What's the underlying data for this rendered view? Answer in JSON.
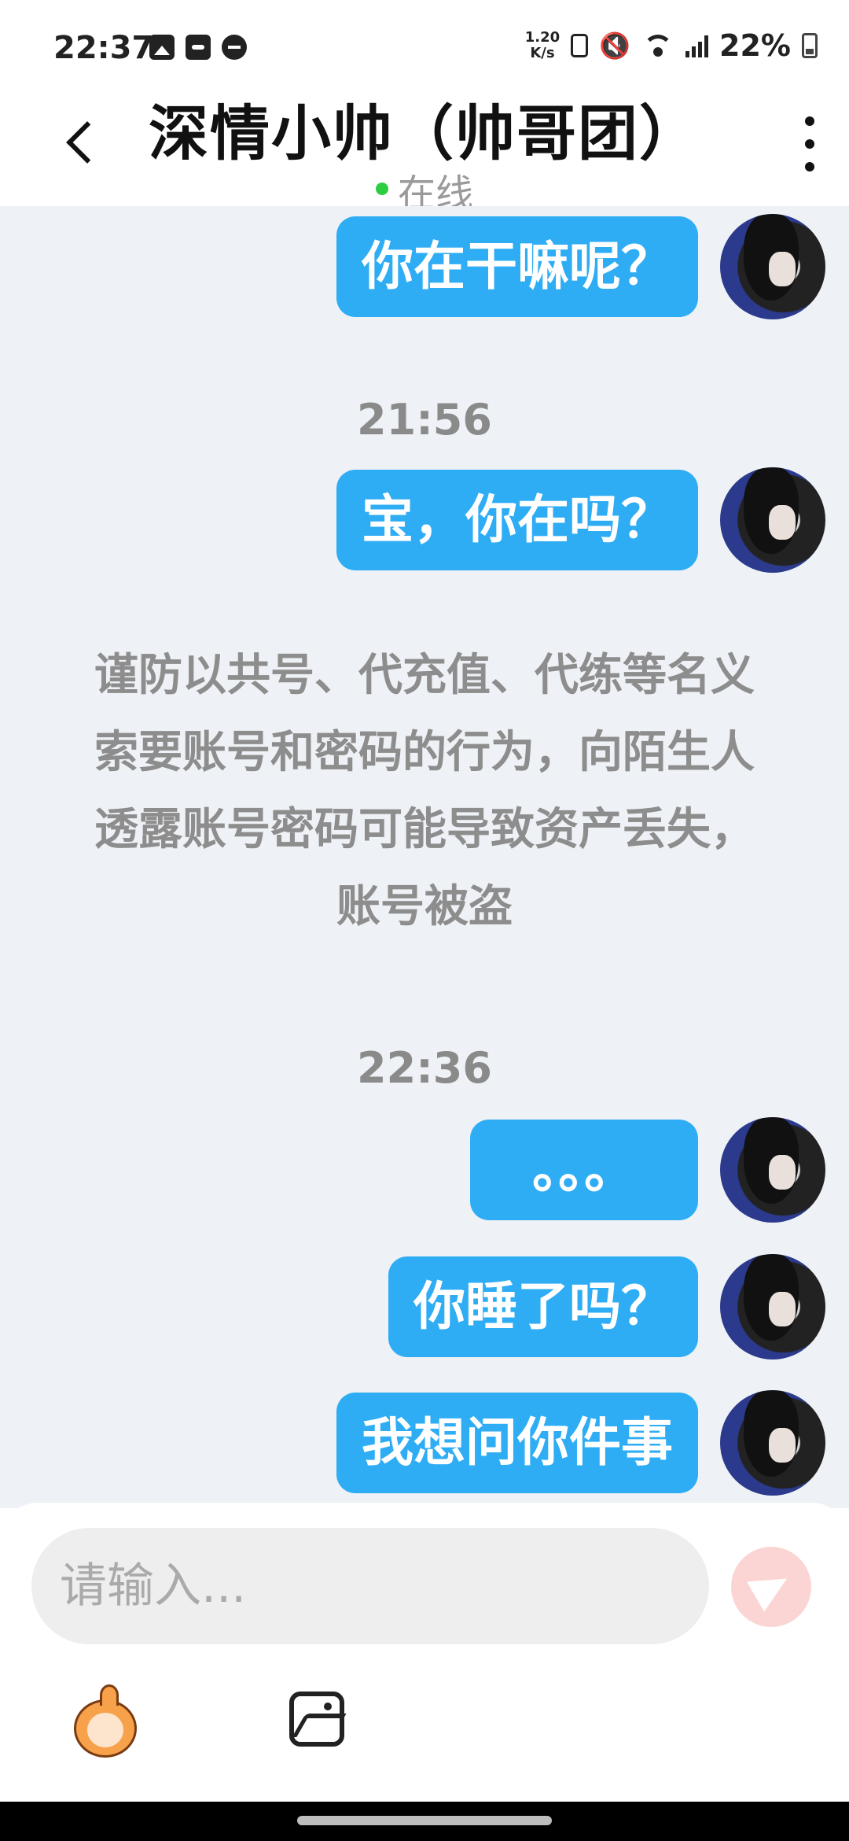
{
  "status_bar": {
    "time": "22:37",
    "net_speed_value": "1.20",
    "net_speed_unit": "K/s",
    "battery_percent": "22%"
  },
  "header": {
    "title": "深情小帅（帅哥团）",
    "status": "在线",
    "status_color": "#2ecc40"
  },
  "chat": {
    "messages": [
      {
        "text": "你在干嘛呢？"
      },
      {
        "text": "宝，你在吗？"
      },
      {
        "text": "。。。"
      },
      {
        "text": "你睡了吗？"
      },
      {
        "text": "我想问你件事"
      }
    ],
    "timestamps": [
      "21:56",
      "22:36"
    ],
    "notice": "谨防以共号、代充值、代练等名义索要账号和密码的行为，向陌生人透露账号密码可能导致资产丢失，账号被盗",
    "bubble_color": "#2eadf5"
  },
  "input": {
    "placeholder": "请输入..."
  },
  "icons": {
    "back": "chevron-left-icon",
    "more": "more-vertical-icon",
    "send": "send-icon",
    "emoji": "emoji-sticker-icon",
    "image": "image-icon"
  }
}
